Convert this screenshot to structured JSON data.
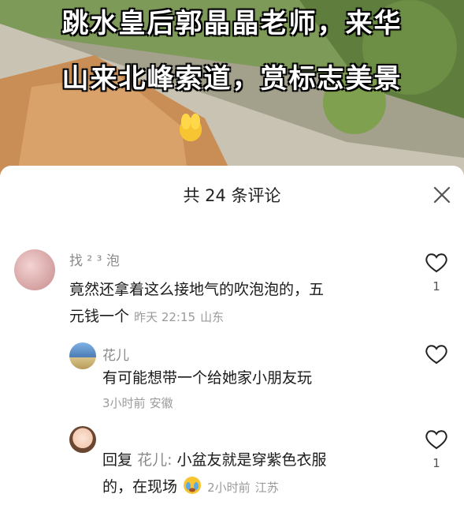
{
  "video": {
    "caption_line1": "跳水皇后郭晶晶老师，来华",
    "caption_line2": "山来北峰索道，赏标志美景",
    "clap_icons": [
      "clapping-hands-icon",
      "clapping-hands-icon",
      "clapping-hands-icon"
    ]
  },
  "sheet": {
    "title": "共 24 条评论",
    "close_icon": "close-icon"
  },
  "comments": [
    {
      "name": "找 ²   ³  泡",
      "text_line1": "竟然还拿着这么接地气的吹泡泡的，五",
      "text_line2": "元钱一个",
      "time": "昨天 22:15",
      "location": "山东",
      "likes": "1"
    },
    {
      "name": "花儿",
      "text": "有可能想带一个给她家小朋友玩",
      "time": "3小时前",
      "location": "安徽"
    },
    {
      "reply_prefix": "回复",
      "reply_to": "花儿:",
      "text_line1": "小盆友就是穿紫色衣服",
      "text_line2": "的，在现场",
      "time": "2小时前",
      "location": "江苏",
      "likes": "1"
    }
  ],
  "colors": {
    "like_outline": "#222222",
    "meta_gray": "#9a9a9a"
  }
}
